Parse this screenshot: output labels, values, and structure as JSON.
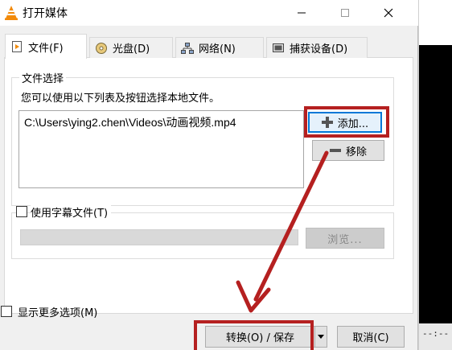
{
  "window": {
    "title": "打开媒体"
  },
  "tabs": [
    {
      "label": "文件(F)",
      "icon": "file-icon"
    },
    {
      "label": "光盘(D)",
      "icon": "disc-icon"
    },
    {
      "label": "网络(N)",
      "icon": "network-icon"
    },
    {
      "label": "捕获设备(D)",
      "icon": "capture-device-icon"
    }
  ],
  "file_selection": {
    "title": "文件选择",
    "hint": "您可以使用以下列表及按钮选择本地文件。",
    "files": [
      "C:\\Users\\ying2.chen\\Videos\\动画视频.mp4"
    ],
    "add_label": "添加...",
    "remove_label": "移除"
  },
  "subtitle": {
    "label": "使用字幕文件(T)",
    "checked": false,
    "browse_label": "浏览..."
  },
  "more_options": {
    "label": "显示更多选项(M)",
    "checked": false
  },
  "buttons": {
    "convert_save": "转换(O) / 保存",
    "cancel": "取消(C)"
  },
  "background": {
    "status_text": "--:--"
  },
  "colors": {
    "highlight": "#b52020",
    "focus": "#0078d7"
  }
}
